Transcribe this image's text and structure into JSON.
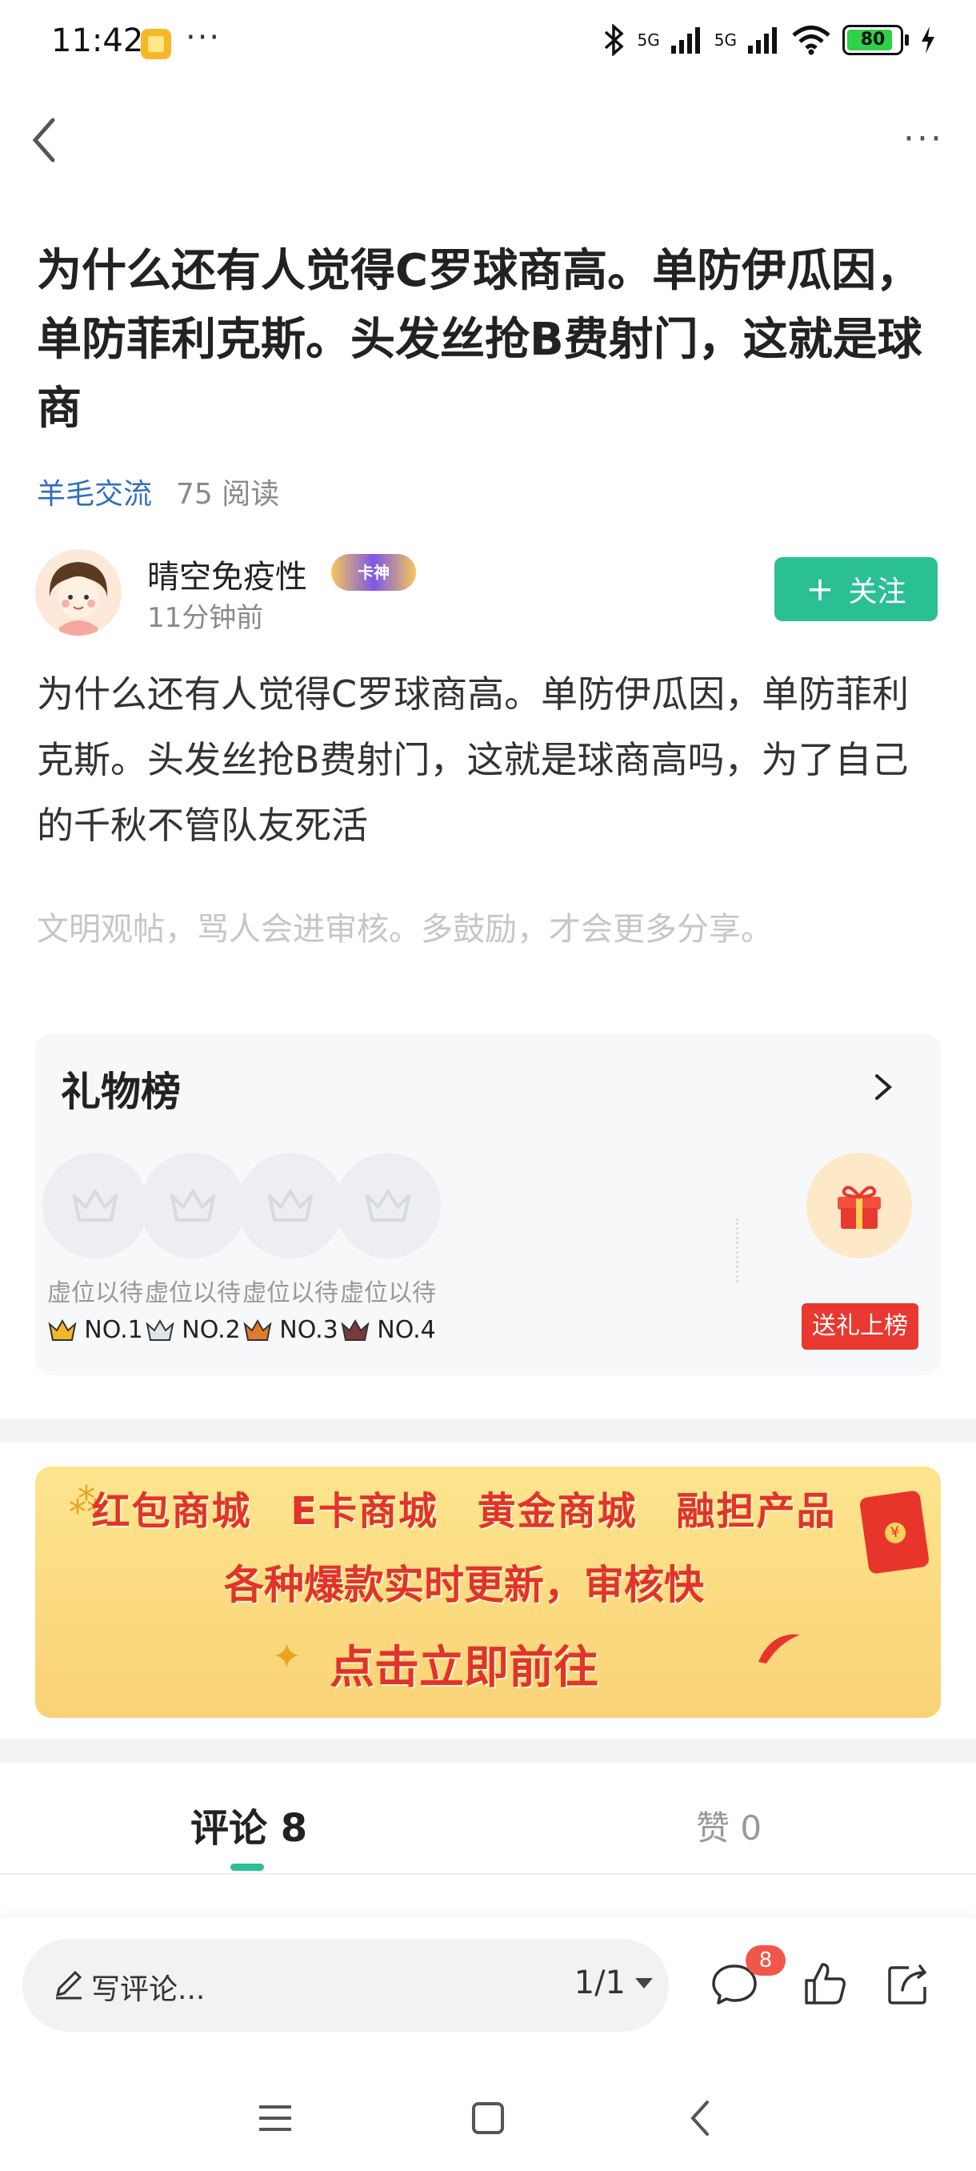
{
  "status_bar": {
    "time": "11:42",
    "dots": "···",
    "signal1": "5G",
    "signal2": "5G",
    "battery": "80",
    "icons": [
      "app-notification-icon",
      "bluetooth-icon",
      "signal-icon",
      "wifi-icon",
      "battery-icon",
      "charging-icon"
    ]
  },
  "nav": {
    "back_icon": "chevron-left-icon",
    "more_label": "···"
  },
  "post": {
    "title": "为什么还有人觉得C罗球商高。单防伊瓜因，单防菲利克斯。头发丝抢B费射门，这就是球商",
    "category": "羊毛交流",
    "read_count": "75 阅读",
    "author": {
      "name": "晴空免疫性",
      "badge": "卡神",
      "time": "11分钟前"
    },
    "follow_label": "关注",
    "body": "为什么还有人觉得C罗球商高。单防伊瓜因，单防菲利克斯。头发丝抢B费射门，这就是球商高吗，为了自己的千秋不管队友死活",
    "notice": "文明观帖，骂人会进审核。多鼓励，才会更多分享。"
  },
  "gift_rank": {
    "title": "礼物榜",
    "slots": [
      {
        "label": "虚位以待",
        "rank": "NO.1",
        "crown_color": "#f2b82a"
      },
      {
        "label": "虚位以待",
        "rank": "NO.2",
        "crown_color": "#9aa3b0"
      },
      {
        "label": "虚位以待",
        "rank": "NO.3",
        "crown_color": "#e07a2c"
      },
      {
        "label": "虚位以待",
        "rank": "NO.4",
        "crown_color": "#7a3a3a"
      }
    ],
    "send_label": "送礼上榜"
  },
  "banner": {
    "line1": "红包商城 E卡商城 黄金商城 融担产品",
    "line2": "各种爆款实时更新，审核快",
    "line3": "点击立即前往"
  },
  "tabs": {
    "comments": "评论 8",
    "likes": "赞 0"
  },
  "bottom_bar": {
    "placeholder": "写评论...",
    "page": "1/1",
    "comment_badge": "8"
  },
  "colors": {
    "accent": "#2bbf94",
    "link": "#2f6fbf",
    "danger": "#e8382f"
  }
}
